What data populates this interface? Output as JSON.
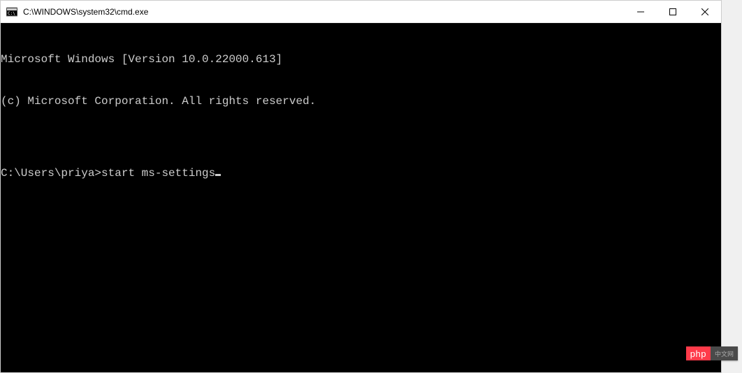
{
  "window": {
    "title": "C:\\WINDOWS\\system32\\cmd.exe"
  },
  "terminal": {
    "line1": "Microsoft Windows [Version 10.0.22000.613]",
    "line2": "(c) Microsoft Corporation. All rights reserved.",
    "blank": "",
    "prompt": "C:\\Users\\priya>",
    "command": "start ms-settings"
  },
  "watermark": {
    "left": "php",
    "right": "中文网"
  }
}
